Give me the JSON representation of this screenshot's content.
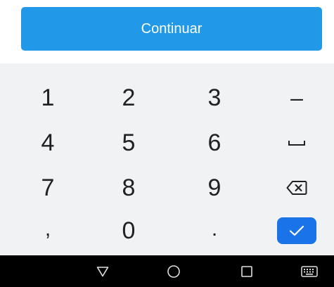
{
  "action": {
    "continue_label": "Continuar"
  },
  "keyboard": {
    "rows": [
      [
        "1",
        "2",
        "3",
        "–"
      ],
      [
        "4",
        "5",
        "6",
        "space"
      ],
      [
        "7",
        "8",
        "9",
        "backspace"
      ],
      [
        ",",
        "0",
        ".",
        "done"
      ]
    ],
    "key_1": "1",
    "key_2": "2",
    "key_3": "3",
    "key_dash": "–",
    "key_4": "4",
    "key_5": "5",
    "key_6": "6",
    "key_7": "7",
    "key_8": "8",
    "key_9": "9",
    "key_comma": ",",
    "key_0": "0",
    "key_period": ".",
    "special_keys": [
      "space-icon",
      "backspace-icon",
      "check-icon"
    ]
  },
  "navbar": {
    "buttons": [
      "back-triangle-icon",
      "home-circle-icon",
      "recents-square-icon",
      "keyboard-icon"
    ]
  },
  "colors": {
    "accent": "#2199e8",
    "done_key": "#1a73e8",
    "keyboard_bg": "#f1f2f4",
    "key_text": "#202124",
    "navbar_bg": "#000000"
  }
}
